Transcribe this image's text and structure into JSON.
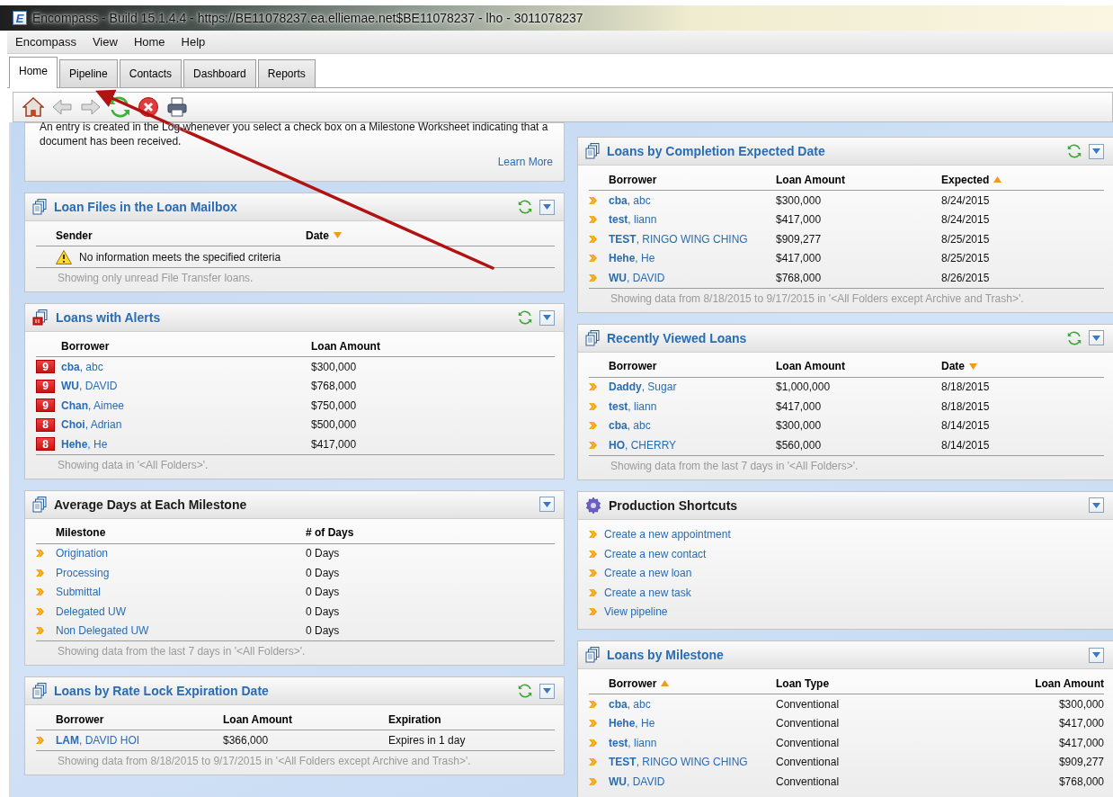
{
  "window": {
    "icon": "E",
    "title": "Encompass - Build 15.1.4.4 - https://BE11078237.ea.elliemae.net$BE11078237 - lho - 3011078237"
  },
  "menu": [
    "Encompass",
    "View",
    "Home",
    "Help"
  ],
  "tabs": [
    {
      "label": "Home",
      "selected": true
    },
    {
      "label": "Pipeline",
      "selected": false
    },
    {
      "label": "Contacts",
      "selected": false
    },
    {
      "label": "Dashboard",
      "selected": false
    },
    {
      "label": "Reports",
      "selected": false
    }
  ],
  "left_panels": [
    {
      "kind": "info",
      "text": "An entry is created in the Log whenever you select a check box on a Milestone Worksheet indicating that a document has been received.",
      "link": "Learn More"
    },
    {
      "kind": "table",
      "title": "Loan Files in the Loan Mailbox",
      "title_link": true,
      "refresh": true,
      "columns": [
        {
          "label": "Sender",
          "sorted": false
        },
        {
          "label": "Date",
          "sorted": true,
          "ascending": false
        }
      ],
      "empty_message": "No information meets the specified criteria",
      "note": "Showing only unread File Transfer loans."
    },
    {
      "kind": "table",
      "title": "Loans with Alerts",
      "title_link": true,
      "refresh": true,
      "columns": [
        {
          "label": "Borrower"
        },
        {
          "label": "Loan Amount"
        }
      ],
      "rows": [
        {
          "kind": "alert",
          "badge": "9",
          "cells": [
            "**cba**, abc",
            "$300,000"
          ]
        },
        {
          "kind": "alert",
          "badge": "9",
          "cells": [
            "**WU**, DAVID",
            "$768,000"
          ]
        },
        {
          "kind": "alert",
          "badge": "9",
          "cells": [
            "**Chan**, Aimee",
            "$750,000"
          ]
        },
        {
          "kind": "alert",
          "badge": "8",
          "cells": [
            "**Choi**, Adrian",
            "$500,000"
          ]
        },
        {
          "kind": "alert",
          "badge": "8",
          "cells": [
            "**Hehe**, He",
            "$417,000"
          ]
        }
      ],
      "note": "Showing data in '<All Folders>'."
    },
    {
      "kind": "table",
      "title": "Average Days at Each Milestone",
      "title_link": false,
      "refresh": false,
      "columns": [
        {
          "label": "Milestone"
        },
        {
          "label": "# of Days"
        }
      ],
      "rows": [
        {
          "kind": "link",
          "cells": [
            "Origination",
            "0 Days"
          ]
        },
        {
          "kind": "link",
          "cells": [
            "Processing",
            "0 Days"
          ]
        },
        {
          "kind": "link",
          "cells": [
            "Submittal",
            "0 Days"
          ]
        },
        {
          "kind": "link",
          "cells": [
            "Delegated UW",
            "0 Days"
          ]
        },
        {
          "kind": "link",
          "cells": [
            "Non Delegated UW",
            "0 Days"
          ]
        }
      ],
      "note": "Showing data from the last 7 days in '<All Folders>'."
    },
    {
      "kind": "table",
      "title": "Loans by Rate Lock Expiration Date",
      "title_link": true,
      "refresh": true,
      "columns": [
        {
          "label": "Borrower"
        },
        {
          "label": "Loan Amount"
        },
        {
          "label": "Expiration"
        }
      ],
      "rows": [
        {
          "kind": "link",
          "cells": [
            "**LAM**, DAVID HOI",
            "$366,000",
            "Expires in 1 day"
          ]
        }
      ],
      "note": "Showing data from 8/18/2015 to 9/17/2015 in '<All Folders except Archive and Trash>'."
    }
  ],
  "right_panels": [
    {
      "kind": "table",
      "title": "Loans by Completion Expected Date",
      "title_link": true,
      "refresh": true,
      "columns": [
        {
          "label": "Borrower",
          "sorted": false
        },
        {
          "label": "Loan Amount",
          "sorted": false
        },
        {
          "label": "Expected",
          "sorted": true,
          "ascending": true
        }
      ],
      "rows": [
        {
          "kind": "link",
          "cells": [
            "**cba**, abc",
            "$300,000",
            "8/24/2015"
          ]
        },
        {
          "kind": "link",
          "cells": [
            "**test**, liann",
            "$417,000",
            "8/24/2015"
          ]
        },
        {
          "kind": "link",
          "cells": [
            "**TEST**, RINGO WING CHING",
            "$909,277",
            "8/25/2015"
          ]
        },
        {
          "kind": "link",
          "cells": [
            "**Hehe**, He",
            "$417,000",
            "8/25/2015"
          ]
        },
        {
          "kind": "link",
          "cells": [
            "**WU**, DAVID",
            "$768,000",
            "8/26/2015"
          ]
        }
      ],
      "note": "Showing data from 8/18/2015 to 9/17/2015 in '<All Folders except Archive and Trash>'."
    },
    {
      "kind": "table",
      "title": "Recently Viewed Loans",
      "title_link": true,
      "refresh": true,
      "columns": [
        {
          "label": "Borrower",
          "sorted": false
        },
        {
          "label": "Loan Amount",
          "sorted": false
        },
        {
          "label": "Date",
          "sorted": true,
          "ascending": false
        }
      ],
      "rows": [
        {
          "kind": "link",
          "cells": [
            "**Daddy**, Sugar",
            "$1,000,000",
            "8/18/2015"
          ]
        },
        {
          "kind": "link",
          "cells": [
            "**test**, liann",
            "$417,000",
            "8/18/2015"
          ]
        },
        {
          "kind": "link",
          "cells": [
            "**cba**, abc",
            "$300,000",
            "8/14/2015"
          ]
        },
        {
          "kind": "link",
          "cells": [
            "**HO**, CHERRY",
            "$560,000",
            "8/14/2015"
          ]
        }
      ],
      "note": "Showing data from the last 7 days in '<All Folders>'."
    },
    {
      "kind": "links",
      "title": "Production Shortcuts",
      "title_link": false,
      "refresh": false,
      "items": [
        "Create a new appointment",
        "Create a new contact",
        "Create a new loan",
        "Create a new task",
        "View pipeline"
      ]
    },
    {
      "kind": "table",
      "title": "Loans by Milestone",
      "title_link": true,
      "refresh": false,
      "columns": [
        {
          "label": "Borrower",
          "sorted": true,
          "ascending": true,
          "right_aligned": false
        },
        {
          "label": "Loan Type",
          "sorted": false,
          "right_aligned": false
        },
        {
          "label": "Loan Amount",
          "sorted": false,
          "right_aligned": true
        }
      ],
      "rows": [
        {
          "kind": "link",
          "cells": [
            "**cba**, abc",
            "Conventional",
            "$300,000"
          ]
        },
        {
          "kind": "link",
          "cells": [
            "**Hehe**, He",
            "Conventional",
            "$417,000"
          ]
        },
        {
          "kind": "link",
          "cells": [
            "**test**, liann",
            "Conventional",
            "$417,000"
          ]
        },
        {
          "kind": "link",
          "cells": [
            "**TEST**, RINGO WING CHING",
            "Conventional",
            "$909,277"
          ]
        },
        {
          "kind": "link",
          "cells": [
            "**WU**, DAVID",
            "Conventional",
            "$768,000"
          ]
        }
      ]
    }
  ]
}
